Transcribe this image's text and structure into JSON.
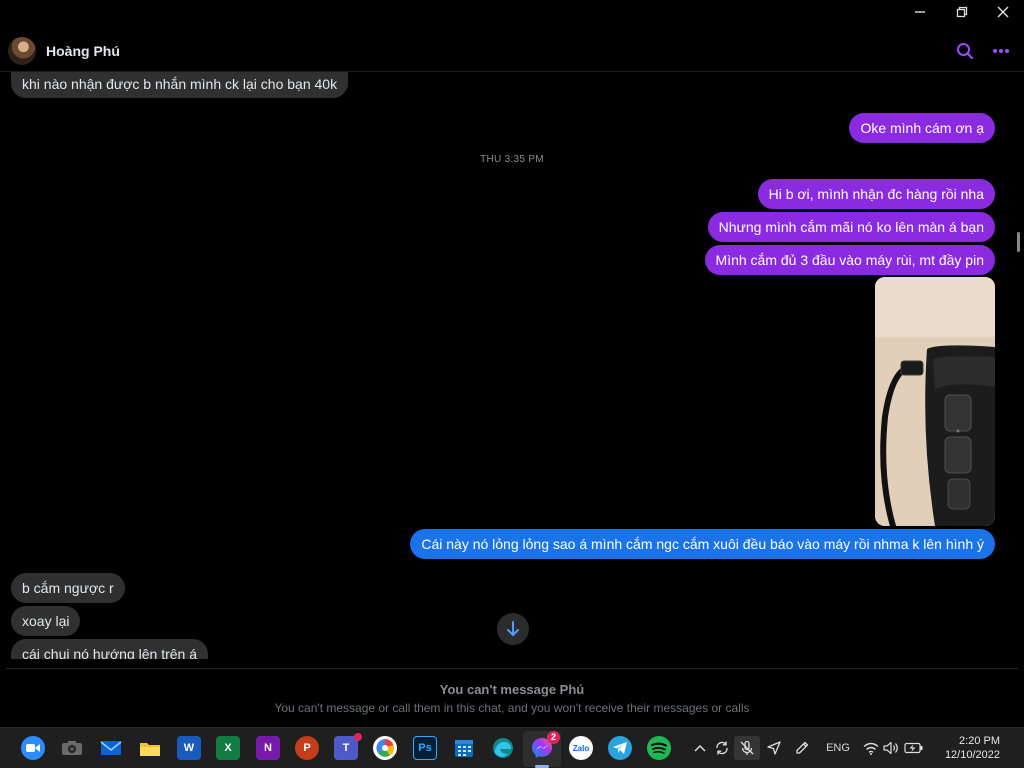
{
  "window": {
    "controls": [
      {
        "name": "minimize",
        "icon": "minimize-icon"
      },
      {
        "name": "restore",
        "icon": "restore-icon"
      },
      {
        "name": "close",
        "icon": "close-icon"
      }
    ]
  },
  "header": {
    "contact_name": "Hoàng Phú",
    "accent_color": "#9b4dff",
    "icons": [
      "search-icon",
      "more-options-icon"
    ]
  },
  "conversation": {
    "timestamp": "THU 3:35 PM",
    "messages": [
      {
        "id": "m1",
        "direction": "incoming",
        "text": "khi nào nhận được b nhắn mình ck lại cho bạn 40k"
      },
      {
        "id": "m2",
        "direction": "outgoing",
        "text": "Oke mình cám ơn ạ",
        "color": "#8a2be2"
      },
      {
        "id": "m3",
        "direction": "outgoing",
        "text": "Hi b ơi, mình nhận đc hàng rồi nha",
        "color": "#8a2be2"
      },
      {
        "id": "m4",
        "direction": "outgoing",
        "text": "Nhưng mình cắm mãi nó ko lên màn á bạn",
        "color": "#8a2be2"
      },
      {
        "id": "m5",
        "direction": "outgoing",
        "text": "Mình cắm đủ 3 đầu vào máy rùi, mt đầy pin",
        "color": "#8a2be2"
      },
      {
        "id": "m6",
        "direction": "outgoing",
        "type": "photo"
      },
      {
        "id": "m7",
        "direction": "outgoing",
        "text": "Cái này nó lỏng lỏng sao á mình cắm ngc cắm xuôi đều báo vào máy rồi nhma k lên hình ý",
        "color": "#1a73e8"
      },
      {
        "id": "m8",
        "direction": "incoming",
        "text": "b cắm ngược r"
      },
      {
        "id": "m9",
        "direction": "incoming",
        "text": "xoay lại"
      },
      {
        "id": "m10",
        "direction": "incoming",
        "text": "cái chui nó hướng lên trên á"
      }
    ]
  },
  "notice": {
    "title": "You can't message Phú",
    "subtitle": "You can't message or call them in this chat, and you won't receive their messages or calls"
  },
  "taskbar": {
    "apps": [
      {
        "name": "zoom",
        "icon": "zoom-icon",
        "color": "#2d8cff"
      },
      {
        "name": "camera",
        "icon": "camera-icon",
        "color": "#3a3a3a"
      },
      {
        "name": "mail",
        "icon": "mail-icon",
        "color": "#0a64d6"
      },
      {
        "name": "file-explorer",
        "icon": "folder-icon",
        "color": "#f4c430"
      },
      {
        "name": "word",
        "icon": "word-icon",
        "color": "#185abd",
        "letter": "W"
      },
      {
        "name": "excel",
        "icon": "excel-icon",
        "color": "#107c41",
        "letter": "X"
      },
      {
        "name": "onenote",
        "icon": "onenote-icon",
        "color": "#7719aa",
        "letter": "N"
      },
      {
        "name": "powerpoint",
        "icon": "powerpoint-icon",
        "color": "#c43e1c",
        "letter": "P"
      },
      {
        "name": "teams",
        "icon": "teams-icon",
        "color": "#5059c9",
        "letter": "T"
      },
      {
        "name": "picasa",
        "icon": "picasa-icon",
        "color": "#ffffff"
      },
      {
        "name": "photoshop",
        "icon": "photoshop-icon",
        "color": "#001e36",
        "letter": "Ps"
      },
      {
        "name": "calendar",
        "icon": "calendar-icon",
        "color": "#0f6cbd"
      },
      {
        "name": "edge",
        "icon": "edge-icon",
        "color": "#0c8a83"
      },
      {
        "name": "messenger",
        "icon": "messenger-icon",
        "color": "#a033ff",
        "badge": "2"
      },
      {
        "name": "zalo",
        "icon": "zalo-icon",
        "color": "#0068ff",
        "letter": "Zalo"
      },
      {
        "name": "telegram",
        "icon": "telegram-icon",
        "color": "#2aa3df"
      },
      {
        "name": "spotify",
        "icon": "spotify-icon",
        "color": "#1db954"
      }
    ],
    "tray": {
      "language": "ENG",
      "icons": [
        "chevron-up-icon",
        "sync-icon",
        "mic-muted-icon",
        "location-icon",
        "pen-icon",
        "wifi-icon",
        "volume-icon",
        "battery-icon"
      ]
    },
    "clock": {
      "time": "2:20 PM",
      "date": "12/10/2022"
    }
  }
}
